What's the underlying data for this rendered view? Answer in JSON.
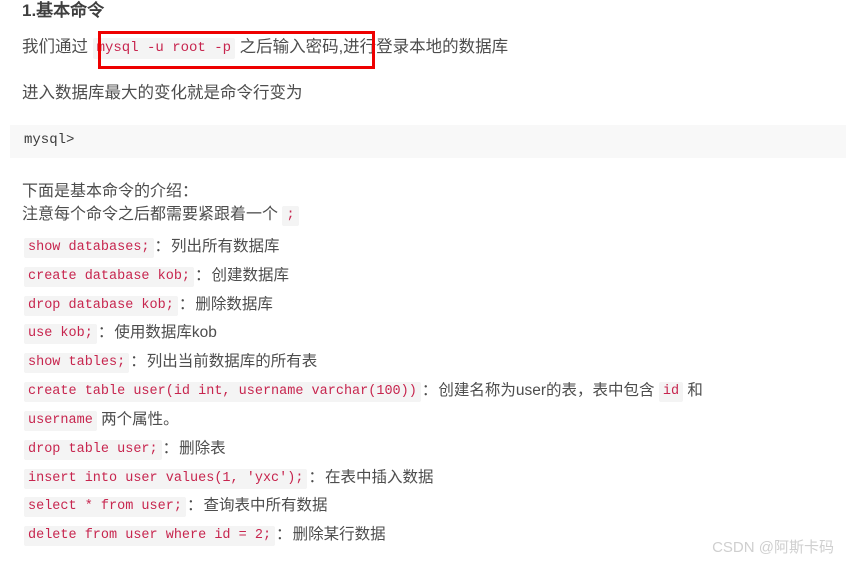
{
  "document": {
    "heading": "1.基本命令",
    "intro_before": "我们通过 ",
    "intro_code": "mysql -u root -p",
    "intro_after": " 之后输入密码,进行登录本地的数据库",
    "change_line": "进入数据库最大的变化就是命令行变为",
    "code_block": "mysql>",
    "below_line": "下面是基本命令的介绍：",
    "note_before": "注意每个命令之后都需要紧跟着一个 ",
    "note_code": ";",
    "commands": [
      {
        "code": "show databases;",
        "colon": "：",
        "desc": "列出所有数据库"
      },
      {
        "code": "create database kob;",
        "colon": "：",
        "desc": "创建数据库"
      },
      {
        "code": "drop database kob;",
        "colon": "：",
        "desc": "删除数据库"
      },
      {
        "code": "use kob;",
        "colon": "：",
        "desc": "使用数据库kob"
      },
      {
        "code": "show tables;",
        "colon": "：",
        "desc": "列出当前数据库的所有表"
      }
    ],
    "create_table": {
      "code": "create table user(id int, username varchar(100))",
      "colon": "：",
      "desc_part1": "创建名称为user的表，表中包含 ",
      "code_id": "id",
      "desc_part2": " 和",
      "code_username": "username",
      "desc_part3": " 两个属性。"
    },
    "commands_tail": [
      {
        "code": "drop table user;",
        "colon": "：",
        "desc": "删除表"
      },
      {
        "code": "insert into user values(1, 'yxc');",
        "colon": "：",
        "desc": "在表中插入数据"
      },
      {
        "code": "select * from user;",
        "colon": "：",
        "desc": "查询表中所有数据"
      },
      {
        "code": "delete from user where id = 2;",
        "colon": "：",
        "desc": "删除某行数据"
      }
    ],
    "watermark": "CSDN @阿斯卡码",
    "colors": {
      "inline_code_text": "#c7254e",
      "inline_code_bg": "#f4f4f4",
      "code_block_bg": "#f8f8f8",
      "annotation_border": "#ee0000",
      "body_text": "#4d4d4d",
      "watermark": "#cfcfcf"
    }
  }
}
